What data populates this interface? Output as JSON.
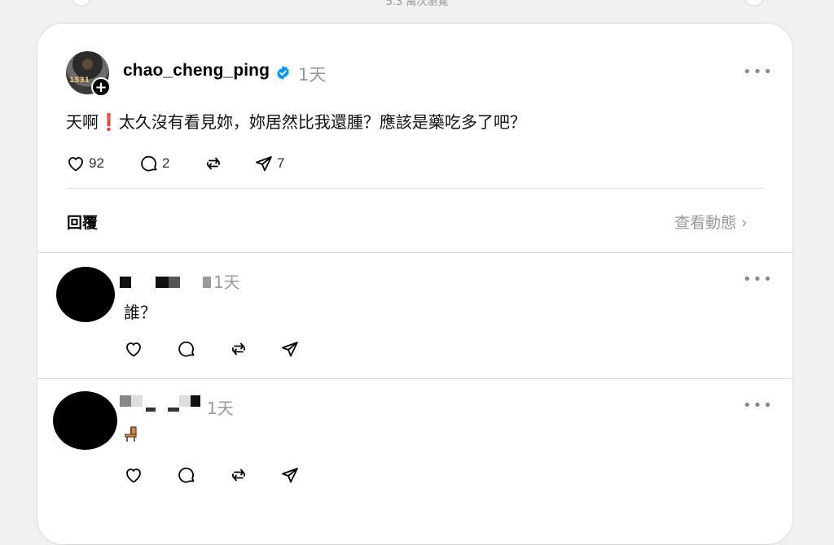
{
  "top": {
    "label": "5.3 萬次瀏覽"
  },
  "post": {
    "username": "chao_cheng_ping",
    "time": "1天",
    "text_before": "天啊",
    "text_emoji": "❗",
    "text_after": "太久沒有看見妳，妳居然比我還腫？應該是藥吃多了吧？",
    "avatar_text": "1531",
    "likes": "92",
    "comments": "2",
    "shares": "7",
    "more": "•••"
  },
  "replies_section": {
    "title": "回覆",
    "view_activity": "查看動態",
    "chevron": "›"
  },
  "replies": [
    {
      "time": "1天",
      "text": "誰？",
      "more": "•••"
    },
    {
      "time": "1天",
      "text": "",
      "emoji": "chair",
      "more": "•••"
    }
  ],
  "colors": {
    "verified": "#0095f6",
    "accent_red": "#d21f2b"
  }
}
